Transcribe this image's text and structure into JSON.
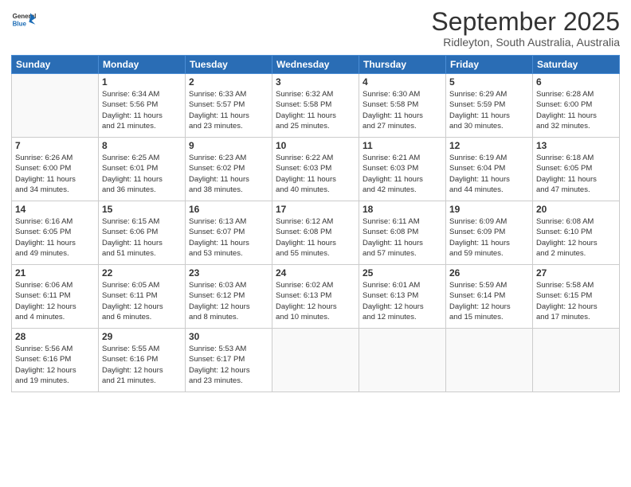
{
  "logo": {
    "general": "General",
    "blue": "Blue"
  },
  "title": "September 2025",
  "subtitle": "Ridleyton, South Australia, Australia",
  "days_of_week": [
    "Sunday",
    "Monday",
    "Tuesday",
    "Wednesday",
    "Thursday",
    "Friday",
    "Saturday"
  ],
  "weeks": [
    [
      {
        "day": "",
        "info": ""
      },
      {
        "day": "1",
        "info": "Sunrise: 6:34 AM\nSunset: 5:56 PM\nDaylight: 11 hours\nand 21 minutes."
      },
      {
        "day": "2",
        "info": "Sunrise: 6:33 AM\nSunset: 5:57 PM\nDaylight: 11 hours\nand 23 minutes."
      },
      {
        "day": "3",
        "info": "Sunrise: 6:32 AM\nSunset: 5:58 PM\nDaylight: 11 hours\nand 25 minutes."
      },
      {
        "day": "4",
        "info": "Sunrise: 6:30 AM\nSunset: 5:58 PM\nDaylight: 11 hours\nand 27 minutes."
      },
      {
        "day": "5",
        "info": "Sunrise: 6:29 AM\nSunset: 5:59 PM\nDaylight: 11 hours\nand 30 minutes."
      },
      {
        "day": "6",
        "info": "Sunrise: 6:28 AM\nSunset: 6:00 PM\nDaylight: 11 hours\nand 32 minutes."
      }
    ],
    [
      {
        "day": "7",
        "info": "Sunrise: 6:26 AM\nSunset: 6:00 PM\nDaylight: 11 hours\nand 34 minutes."
      },
      {
        "day": "8",
        "info": "Sunrise: 6:25 AM\nSunset: 6:01 PM\nDaylight: 11 hours\nand 36 minutes."
      },
      {
        "day": "9",
        "info": "Sunrise: 6:23 AM\nSunset: 6:02 PM\nDaylight: 11 hours\nand 38 minutes."
      },
      {
        "day": "10",
        "info": "Sunrise: 6:22 AM\nSunset: 6:03 PM\nDaylight: 11 hours\nand 40 minutes."
      },
      {
        "day": "11",
        "info": "Sunrise: 6:21 AM\nSunset: 6:03 PM\nDaylight: 11 hours\nand 42 minutes."
      },
      {
        "day": "12",
        "info": "Sunrise: 6:19 AM\nSunset: 6:04 PM\nDaylight: 11 hours\nand 44 minutes."
      },
      {
        "day": "13",
        "info": "Sunrise: 6:18 AM\nSunset: 6:05 PM\nDaylight: 11 hours\nand 47 minutes."
      }
    ],
    [
      {
        "day": "14",
        "info": "Sunrise: 6:16 AM\nSunset: 6:05 PM\nDaylight: 11 hours\nand 49 minutes."
      },
      {
        "day": "15",
        "info": "Sunrise: 6:15 AM\nSunset: 6:06 PM\nDaylight: 11 hours\nand 51 minutes."
      },
      {
        "day": "16",
        "info": "Sunrise: 6:13 AM\nSunset: 6:07 PM\nDaylight: 11 hours\nand 53 minutes."
      },
      {
        "day": "17",
        "info": "Sunrise: 6:12 AM\nSunset: 6:08 PM\nDaylight: 11 hours\nand 55 minutes."
      },
      {
        "day": "18",
        "info": "Sunrise: 6:11 AM\nSunset: 6:08 PM\nDaylight: 11 hours\nand 57 minutes."
      },
      {
        "day": "19",
        "info": "Sunrise: 6:09 AM\nSunset: 6:09 PM\nDaylight: 11 hours\nand 59 minutes."
      },
      {
        "day": "20",
        "info": "Sunrise: 6:08 AM\nSunset: 6:10 PM\nDaylight: 12 hours\nand 2 minutes."
      }
    ],
    [
      {
        "day": "21",
        "info": "Sunrise: 6:06 AM\nSunset: 6:11 PM\nDaylight: 12 hours\nand 4 minutes."
      },
      {
        "day": "22",
        "info": "Sunrise: 6:05 AM\nSunset: 6:11 PM\nDaylight: 12 hours\nand 6 minutes."
      },
      {
        "day": "23",
        "info": "Sunrise: 6:03 AM\nSunset: 6:12 PM\nDaylight: 12 hours\nand 8 minutes."
      },
      {
        "day": "24",
        "info": "Sunrise: 6:02 AM\nSunset: 6:13 PM\nDaylight: 12 hours\nand 10 minutes."
      },
      {
        "day": "25",
        "info": "Sunrise: 6:01 AM\nSunset: 6:13 PM\nDaylight: 12 hours\nand 12 minutes."
      },
      {
        "day": "26",
        "info": "Sunrise: 5:59 AM\nSunset: 6:14 PM\nDaylight: 12 hours\nand 15 minutes."
      },
      {
        "day": "27",
        "info": "Sunrise: 5:58 AM\nSunset: 6:15 PM\nDaylight: 12 hours\nand 17 minutes."
      }
    ],
    [
      {
        "day": "28",
        "info": "Sunrise: 5:56 AM\nSunset: 6:16 PM\nDaylight: 12 hours\nand 19 minutes."
      },
      {
        "day": "29",
        "info": "Sunrise: 5:55 AM\nSunset: 6:16 PM\nDaylight: 12 hours\nand 21 minutes."
      },
      {
        "day": "30",
        "info": "Sunrise: 5:53 AM\nSunset: 6:17 PM\nDaylight: 12 hours\nand 23 minutes."
      },
      {
        "day": "",
        "info": ""
      },
      {
        "day": "",
        "info": ""
      },
      {
        "day": "",
        "info": ""
      },
      {
        "day": "",
        "info": ""
      }
    ]
  ]
}
